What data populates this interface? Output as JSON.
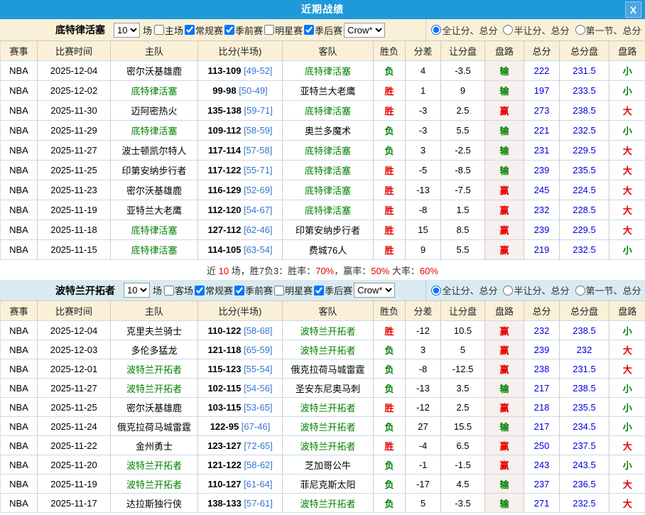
{
  "window": {
    "title": "近期战绩",
    "close_label": "X"
  },
  "colors": {
    "titlebar_blue": "#1f9ad8",
    "section1_bg": "#faf0d8",
    "section2_bg": "#d9ebf1",
    "win_red": "#e80000",
    "loss_green": "#008000",
    "total_blue": "#0000dd",
    "half_score_blue": "#3377cc"
  },
  "summary": {
    "parts": [
      {
        "text": "近 ",
        "red": false
      },
      {
        "text": "10",
        "red": true
      },
      {
        "text": " 场，胜7负3：胜率：",
        "red": false
      },
      {
        "text": "70%",
        "red": true
      },
      {
        "text": "，赢率：",
        "red": false
      },
      {
        "text": "50%",
        "red": true
      },
      {
        "text": " 大率：",
        "red": false
      },
      {
        "text": "60%",
        "red": true
      }
    ]
  },
  "sections": [
    {
      "team": "底特律活塞",
      "bar": {
        "games_selected": "10",
        "games_suffix": "场",
        "checkboxes": [
          {
            "label": "主场",
            "checked": false
          },
          {
            "label": "常规赛",
            "checked": true
          },
          {
            "label": "季前赛",
            "checked": true
          },
          {
            "label": "明星赛",
            "checked": false
          },
          {
            "label": "季后赛",
            "checked": true
          }
        ],
        "bookmaker_selected": "Crow*",
        "radios": [
          {
            "label": "全让分、总分",
            "checked": true
          },
          {
            "label": "半让分、总分",
            "checked": false
          },
          {
            "label": "第一节、总分",
            "checked": false
          }
        ]
      },
      "table": {
        "headers": [
          "赛事",
          "比赛时间",
          "主队",
          "比分(半场)",
          "客队",
          "胜负",
          "分差",
          "让分盘",
          "盘路",
          "总分",
          "总分盘",
          "盘路"
        ],
        "rows": [
          {
            "league": "NBA",
            "date": "2025-12-04",
            "home": "密尔沃基雄鹿",
            "score": "113-109",
            "half": "[49-52]",
            "away": "底特律活塞",
            "self": "away",
            "result": "负",
            "diff": "4",
            "handicap": "-3.5",
            "handicap_outcome": "输",
            "total": "222",
            "total_line": "231.5",
            "ou": "小"
          },
          {
            "league": "NBA",
            "date": "2025-12-02",
            "home": "底特律活塞",
            "score": "99-98",
            "half": "[50-49]",
            "away": "亚特兰大老鹰",
            "self": "home",
            "result": "胜",
            "diff": "1",
            "handicap": "9",
            "handicap_outcome": "输",
            "total": "197",
            "total_line": "233.5",
            "ou": "小"
          },
          {
            "league": "NBA",
            "date": "2025-11-30",
            "home": "迈阿密热火",
            "score": "135-138",
            "half": "[59-71]",
            "away": "底特律活塞",
            "self": "away",
            "result": "胜",
            "diff": "-3",
            "handicap": "2.5",
            "handicap_outcome": "赢",
            "total": "273",
            "total_line": "238.5",
            "ou": "大"
          },
          {
            "league": "NBA",
            "date": "2025-11-29",
            "home": "底特律活塞",
            "score": "109-112",
            "half": "[58-59]",
            "away": "奥兰多魔术",
            "self": "home",
            "result": "负",
            "diff": "-3",
            "handicap": "5.5",
            "handicap_outcome": "输",
            "total": "221",
            "total_line": "232.5",
            "ou": "小"
          },
          {
            "league": "NBA",
            "date": "2025-11-27",
            "home": "波士顿凯尔特人",
            "score": "117-114",
            "half": "[57-58]",
            "away": "底特律活塞",
            "self": "away",
            "result": "负",
            "diff": "3",
            "handicap": "-2.5",
            "handicap_outcome": "输",
            "total": "231",
            "total_line": "229.5",
            "ou": "大"
          },
          {
            "league": "NBA",
            "date": "2025-11-25",
            "home": "印第安纳步行者",
            "score": "117-122",
            "half": "[55-71]",
            "away": "底特律活塞",
            "self": "away",
            "result": "胜",
            "diff": "-5",
            "handicap": "-8.5",
            "handicap_outcome": "输",
            "total": "239",
            "total_line": "235.5",
            "ou": "大"
          },
          {
            "league": "NBA",
            "date": "2025-11-23",
            "home": "密尔沃基雄鹿",
            "score": "116-129",
            "half": "[52-69]",
            "away": "底特律活塞",
            "self": "away",
            "result": "胜",
            "diff": "-13",
            "handicap": "-7.5",
            "handicap_outcome": "赢",
            "total": "245",
            "total_line": "224.5",
            "ou": "大"
          },
          {
            "league": "NBA",
            "date": "2025-11-19",
            "home": "亚特兰大老鹰",
            "score": "112-120",
            "half": "[54-67]",
            "away": "底特律活塞",
            "self": "away",
            "result": "胜",
            "diff": "-8",
            "handicap": "1.5",
            "handicap_outcome": "赢",
            "total": "232",
            "total_line": "228.5",
            "ou": "大"
          },
          {
            "league": "NBA",
            "date": "2025-11-18",
            "home": "底特律活塞",
            "score": "127-112",
            "half": "[62-46]",
            "away": "印第安纳步行者",
            "self": "home",
            "result": "胜",
            "diff": "15",
            "handicap": "8.5",
            "handicap_outcome": "赢",
            "total": "239",
            "total_line": "229.5",
            "ou": "大"
          },
          {
            "league": "NBA",
            "date": "2025-11-15",
            "home": "底特律活塞",
            "score": "114-105",
            "half": "[63-54]",
            "away": "费城76人",
            "self": "home",
            "result": "胜",
            "diff": "9",
            "handicap": "5.5",
            "handicap_outcome": "赢",
            "total": "219",
            "total_line": "232.5",
            "ou": "小"
          }
        ]
      }
    },
    {
      "team": "波特兰开拓者",
      "bar": {
        "games_selected": "10",
        "games_suffix": "场",
        "checkboxes": [
          {
            "label": "客场",
            "checked": false
          },
          {
            "label": "常规赛",
            "checked": true
          },
          {
            "label": "季前赛",
            "checked": true
          },
          {
            "label": "明星赛",
            "checked": false
          },
          {
            "label": "季后赛",
            "checked": true
          }
        ],
        "bookmaker_selected": "Crow*",
        "radios": [
          {
            "label": "全让分、总分",
            "checked": true
          },
          {
            "label": "半让分、总分",
            "checked": false
          },
          {
            "label": "第一节、总分",
            "checked": false
          }
        ]
      },
      "table": {
        "headers": [
          "赛事",
          "比赛时间",
          "主队",
          "比分(半场)",
          "客队",
          "胜负",
          "分差",
          "让分盘",
          "盘路",
          "总分",
          "总分盘",
          "盘路"
        ],
        "rows": [
          {
            "league": "NBA",
            "date": "2025-12-04",
            "home": "克里夫兰骑士",
            "score": "110-122",
            "half": "[58-68]",
            "away": "波特兰开拓者",
            "self": "away",
            "result": "胜",
            "diff": "-12",
            "handicap": "10.5",
            "handicap_outcome": "赢",
            "total": "232",
            "total_line": "238.5",
            "ou": "小"
          },
          {
            "league": "NBA",
            "date": "2025-12-03",
            "home": "多伦多猛龙",
            "score": "121-118",
            "half": "[65-59]",
            "away": "波特兰开拓者",
            "self": "away",
            "result": "负",
            "diff": "3",
            "handicap": "5",
            "handicap_outcome": "赢",
            "total": "239",
            "total_line": "232",
            "ou": "大"
          },
          {
            "league": "NBA",
            "date": "2025-12-01",
            "home": "波特兰开拓者",
            "score": "115-123",
            "half": "[55-54]",
            "away": "俄克拉荷马城雷霆",
            "self": "home",
            "result": "负",
            "diff": "-8",
            "handicap": "-12.5",
            "handicap_outcome": "赢",
            "total": "238",
            "total_line": "231.5",
            "ou": "大"
          },
          {
            "league": "NBA",
            "date": "2025-11-27",
            "home": "波特兰开拓者",
            "score": "102-115",
            "half": "[54-56]",
            "away": "圣安东尼奥马刺",
            "self": "home",
            "result": "负",
            "diff": "-13",
            "handicap": "3.5",
            "handicap_outcome": "输",
            "total": "217",
            "total_line": "238.5",
            "ou": "小"
          },
          {
            "league": "NBA",
            "date": "2025-11-25",
            "home": "密尔沃基雄鹿",
            "score": "103-115",
            "half": "[53-65]",
            "away": "波特兰开拓者",
            "self": "away",
            "result": "胜",
            "diff": "-12",
            "handicap": "2.5",
            "handicap_outcome": "赢",
            "total": "218",
            "total_line": "235.5",
            "ou": "小"
          },
          {
            "league": "NBA",
            "date": "2025-11-24",
            "home": "俄克拉荷马城雷霆",
            "score": "122-95",
            "half": "[67-46]",
            "away": "波特兰开拓者",
            "self": "away",
            "result": "负",
            "diff": "27",
            "handicap": "15.5",
            "handicap_outcome": "输",
            "total": "217",
            "total_line": "234.5",
            "ou": "小"
          },
          {
            "league": "NBA",
            "date": "2025-11-22",
            "home": "金州勇士",
            "score": "123-127",
            "half": "[72-65]",
            "away": "波特兰开拓者",
            "self": "away",
            "result": "胜",
            "diff": "-4",
            "handicap": "6.5",
            "handicap_outcome": "赢",
            "total": "250",
            "total_line": "237.5",
            "ou": "大"
          },
          {
            "league": "NBA",
            "date": "2025-11-20",
            "home": "波特兰开拓者",
            "score": "121-122",
            "half": "[58-62]",
            "away": "芝加哥公牛",
            "self": "home",
            "result": "负",
            "diff": "-1",
            "handicap": "-1.5",
            "handicap_outcome": "赢",
            "total": "243",
            "total_line": "243.5",
            "ou": "小"
          },
          {
            "league": "NBA",
            "date": "2025-11-19",
            "home": "波特兰开拓者",
            "score": "110-127",
            "half": "[61-64]",
            "away": "菲尼克斯太阳",
            "self": "home",
            "result": "负",
            "diff": "-17",
            "handicap": "4.5",
            "handicap_outcome": "输",
            "total": "237",
            "total_line": "236.5",
            "ou": "大"
          },
          {
            "league": "NBA",
            "date": "2025-11-17",
            "home": "达拉斯独行侠",
            "score": "138-133",
            "half": "[57-61]",
            "away": "波特兰开拓者",
            "self": "away",
            "result": "负",
            "diff": "5",
            "handicap": "-3.5",
            "handicap_outcome": "输",
            "total": "271",
            "total_line": "232.5",
            "ou": "大"
          }
        ]
      }
    }
  ]
}
